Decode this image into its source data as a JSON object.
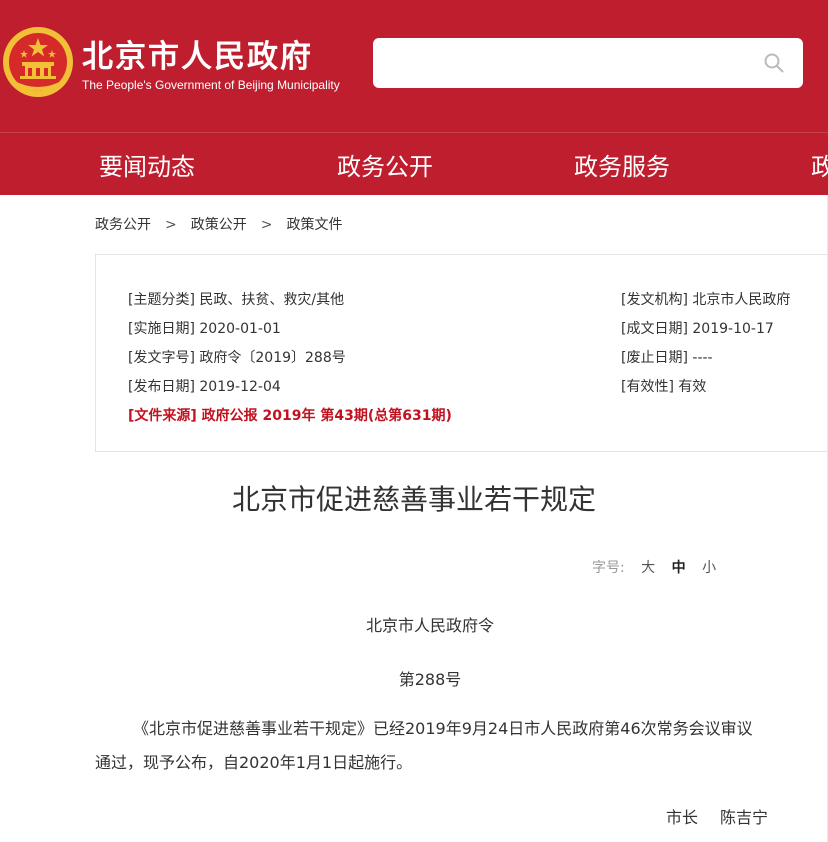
{
  "header": {
    "title": "北京市人民政府",
    "subtitle": "The People's Government of Beijing Municipality",
    "search": {
      "placeholder": ""
    }
  },
  "nav": {
    "items": [
      {
        "label": "要闻动态"
      },
      {
        "label": "政务公开"
      },
      {
        "label": "政务服务"
      },
      {
        "label": "政"
      }
    ]
  },
  "breadcrumb": {
    "items": [
      "政务公开",
      "政策公开",
      "政策文件"
    ],
    "separator": ">"
  },
  "info": {
    "topic": {
      "label": "[主题分类]",
      "value": "民政、扶贫、救灾/其他"
    },
    "issuer": {
      "label": "[发文机构]",
      "value": "北京市人民政府"
    },
    "effective": {
      "label": "[实施日期]",
      "value": "2020-01-01"
    },
    "written": {
      "label": "[成文日期]",
      "value": "2019-10-17"
    },
    "doc_no": {
      "label": "[发文字号]",
      "value": "政府令〔2019〕288号"
    },
    "repeal": {
      "label": "[废止日期]",
      "value": "----"
    },
    "published": {
      "label": "[发布日期]",
      "value": "2019-12-04"
    },
    "validity": {
      "label": "[有效性]",
      "value": "有效"
    },
    "source": {
      "label": "[文件来源]",
      "value": "政府公报 2019年 第43期(总第631期)"
    }
  },
  "article": {
    "title": "北京市促进慈善事业若干规定",
    "font_size": {
      "label": "字号:",
      "large": "大",
      "medium": "中",
      "small": "小"
    },
    "decree_issuer": "北京市人民政府令",
    "decree_number": "第288号",
    "body": "《北京市促进慈善事业若干规定》已经2019年9月24日市人民政府第46次常务会议审议通过，现予公布，自2020年1月1日起施行。",
    "signature_title": "市长",
    "signature_name": "陈吉宁"
  },
  "colors": {
    "brand_red": "#bf1e2e",
    "source_red": "#c1121f",
    "emblem_gold": "#f2c037"
  }
}
